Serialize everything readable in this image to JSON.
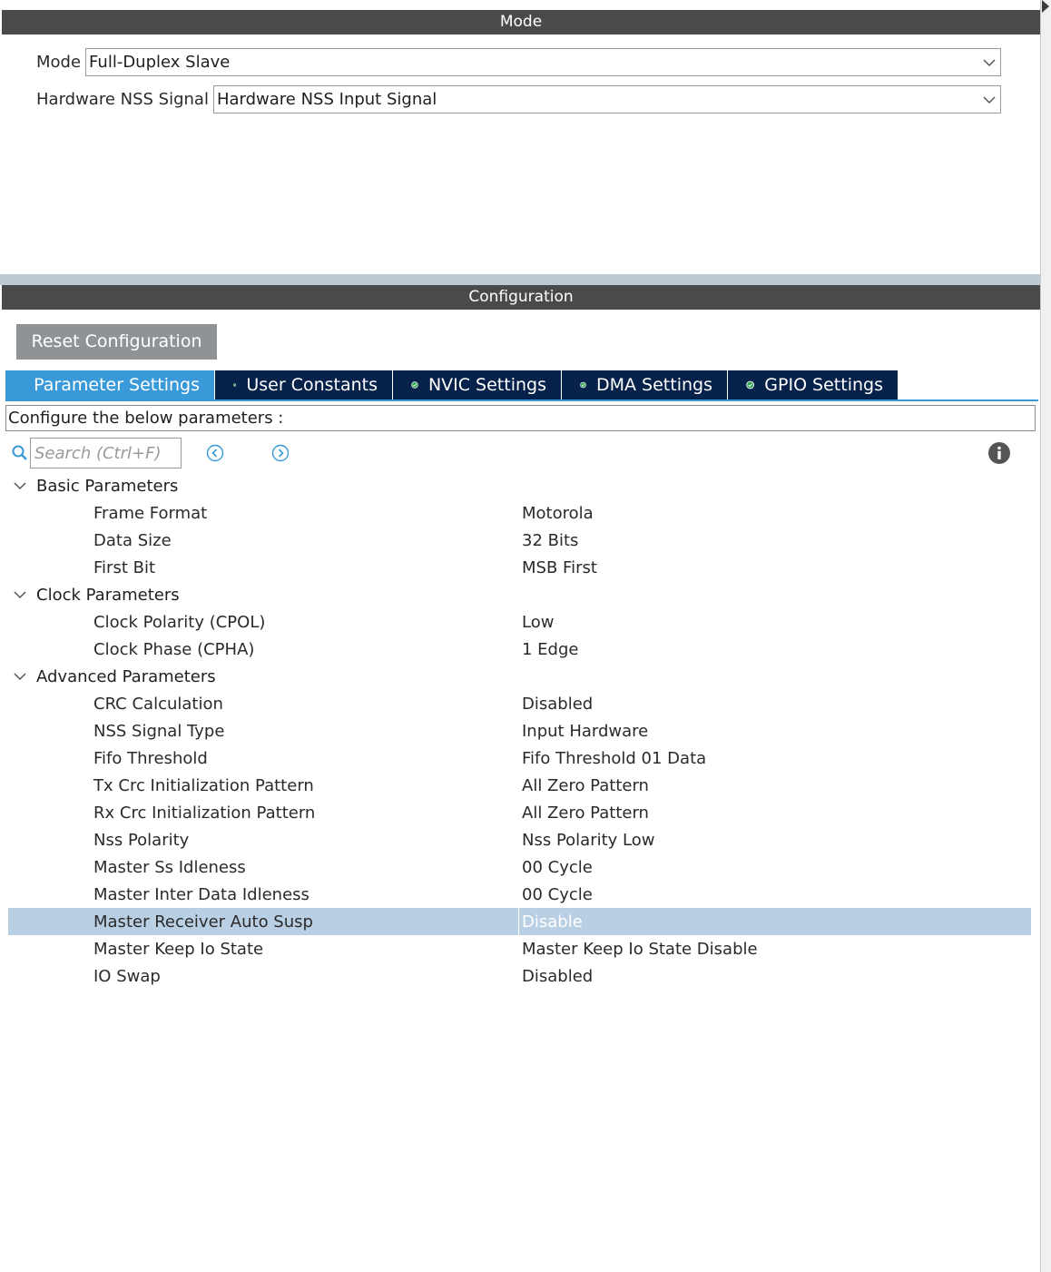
{
  "mode_panel": {
    "title": "Mode",
    "mode_label": "Mode",
    "mode_value": "Full-Duplex Slave",
    "nss_label": "Hardware NSS Signal",
    "nss_value": "Hardware NSS Input Signal"
  },
  "config_panel": {
    "title": "Configuration",
    "reset_label": "Reset Configuration",
    "tabs": [
      {
        "label": "Parameter Settings",
        "active": true
      },
      {
        "label": "User Constants",
        "active": false
      },
      {
        "label": "NVIC Settings",
        "active": false
      },
      {
        "label": "DMA Settings",
        "active": false
      },
      {
        "label": "GPIO Settings",
        "active": false
      }
    ],
    "hint": "Configure the below parameters :",
    "search_placeholder": "Search (Ctrl+F)",
    "groups": [
      {
        "name": "Basic Parameters",
        "params": [
          {
            "name": "Frame Format",
            "value": "Motorola"
          },
          {
            "name": "Data Size",
            "value": "32 Bits"
          },
          {
            "name": "First Bit",
            "value": "MSB First"
          }
        ]
      },
      {
        "name": "Clock Parameters",
        "params": [
          {
            "name": "Clock Polarity (CPOL)",
            "value": "Low"
          },
          {
            "name": "Clock Phase (CPHA)",
            "value": "1 Edge"
          }
        ]
      },
      {
        "name": "Advanced Parameters",
        "params": [
          {
            "name": "CRC Calculation",
            "value": "Disabled"
          },
          {
            "name": "NSS Signal Type",
            "value": "Input Hardware"
          },
          {
            "name": "Fifo Threshold",
            "value": "Fifo Threshold 01 Data"
          },
          {
            "name": "Tx Crc Initialization Pattern",
            "value": "All Zero Pattern"
          },
          {
            "name": "Rx Crc Initialization Pattern",
            "value": "All Zero Pattern"
          },
          {
            "name": "Nss Polarity",
            "value": "Nss Polarity Low"
          },
          {
            "name": "Master Ss Idleness",
            "value": "00 Cycle"
          },
          {
            "name": "Master Inter Data Idleness",
            "value": "00 Cycle"
          },
          {
            "name": "Master Receiver Auto Susp",
            "value": "Disable",
            "selected": true
          },
          {
            "name": "Master Keep Io State",
            "value": "Master Keep Io State Disable"
          },
          {
            "name": "IO Swap",
            "value": "Disabled"
          }
        ]
      }
    ]
  },
  "colors": {
    "header_bg": "#4a4a4a",
    "tab_bg": "#06224a",
    "tab_active_bg": "#3a9ad9",
    "selected_row_bg": "#b9cfe4",
    "reset_button_bg": "#8f9396",
    "check_icon": "#2ea44f"
  }
}
